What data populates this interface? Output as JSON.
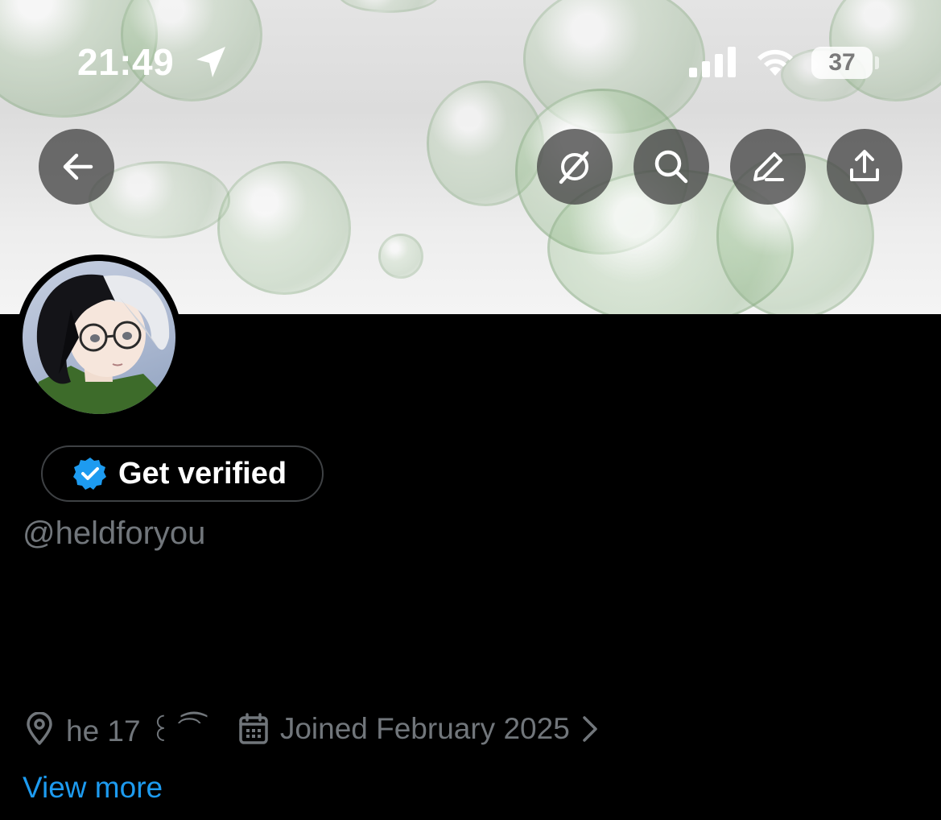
{
  "status_bar": {
    "time": "21:49",
    "battery": "37"
  },
  "profile": {
    "verify_label": "Get verified",
    "handle": "@heldforyou",
    "location": "he 17 ꒰ ͡",
    "location_suffix": "⁀",
    "joined": "Joined February 2025",
    "view_more": "View more"
  },
  "colors": {
    "accent": "#1d9bf0",
    "muted": "#71767b",
    "background": "#000000"
  },
  "icons": {
    "back": "arrow-left-icon",
    "grok": "grok-icon",
    "search": "search-icon",
    "edit": "pencil-icon",
    "share": "share-icon",
    "location": "location-pin-icon",
    "calendar": "calendar-icon",
    "verified": "verified-badge-icon"
  }
}
